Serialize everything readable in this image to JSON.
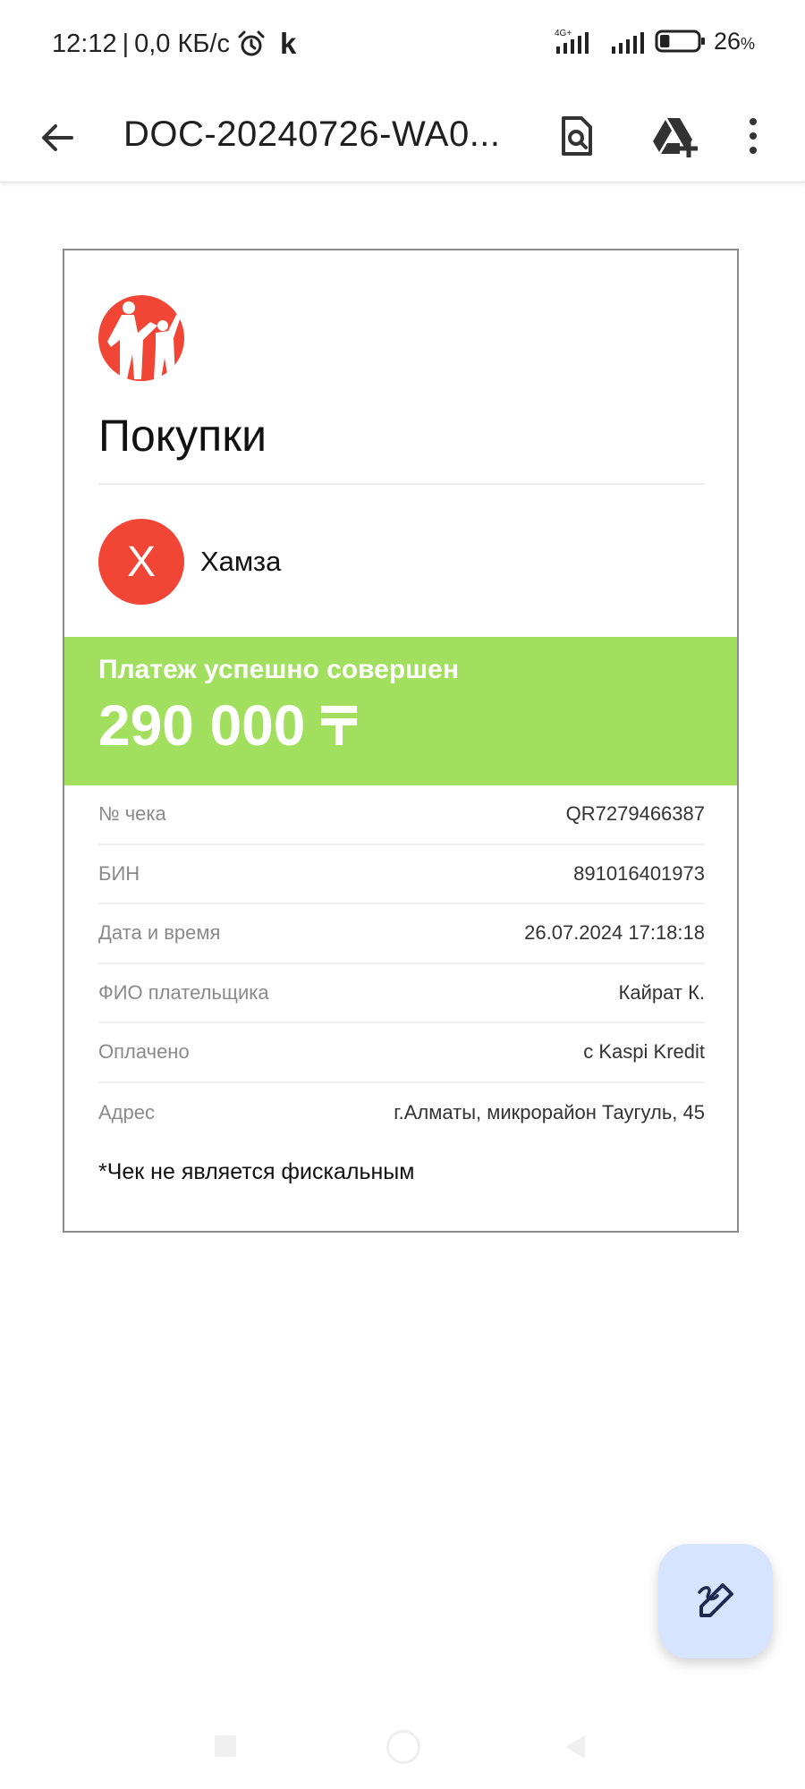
{
  "status_bar": {
    "time": "12:12",
    "separator": "|",
    "speed": "0,0 КБ/с",
    "carrier_letter": "k",
    "network": "4G+",
    "battery_value": "26",
    "battery_unit": "%",
    "battery_level": 0.26
  },
  "app_bar": {
    "title": "DOC-20240726-WA0..."
  },
  "document": {
    "title": "Покупки",
    "merchant_initial": "Х",
    "merchant_name": "Хамза",
    "payment_status": "Платеж успешно совершен",
    "amount": "290 000",
    "rows": [
      {
        "label": "№ чека",
        "value": "QR7279466387"
      },
      {
        "label": "БИН",
        "value": "891016401973"
      },
      {
        "label": "Дата и время",
        "value": "26.07.2024 17:18:18"
      },
      {
        "label": "ФИО плательщика",
        "value": "Кайрат К."
      },
      {
        "label": "Оплачено",
        "value": "с Kaspi Kredit"
      },
      {
        "label": "Адрес",
        "value": "г.Алматы, микрорайон Таугуль, 45"
      }
    ],
    "note": "*Чек не является фискальным"
  },
  "colors": {
    "brand_red": "#f14635",
    "success_green": "#a3df5e",
    "fab_bg": "#d7e4ff"
  }
}
